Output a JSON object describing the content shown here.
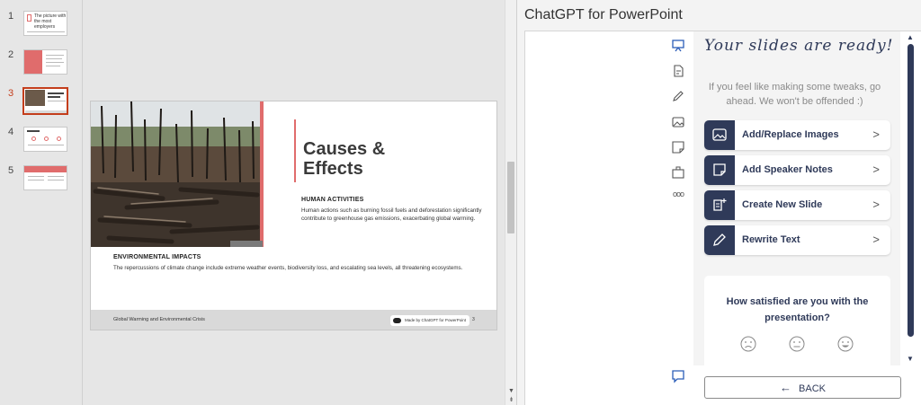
{
  "thumbnails": {
    "items": [
      {
        "num": "1",
        "text": "The picture with the most employers"
      },
      {
        "num": "2",
        "text": ""
      },
      {
        "num": "3",
        "text": "Causes & Effects"
      },
      {
        "num": "4",
        "text": ""
      },
      {
        "num": "5",
        "text": ""
      }
    ],
    "active": "3"
  },
  "slide": {
    "title": "Causes &\nEffects",
    "section1_heading": "HUMAN ACTIVITIES",
    "section1_body": "Human actions such as burning fossil fuels and deforestation significantly contribute to greenhouse gas emissions, exacerbating global warming.",
    "section2_heading": "ENVIRONMENTAL IMPACTS",
    "section2_body": "The repercussions of climate change include extreme weather events, biodiversity loss, and escalating sea levels, all threatening ecosystems.",
    "footer_text": "Global Warming and Environmental Crisis",
    "made_by": "Made by ChatGPT for PowerPoint",
    "page_number": "3"
  },
  "pane": {
    "title": "ChatGPT for PowerPoint",
    "heading": "Your slides are ready!",
    "intro": "If you feel like making some tweaks, go ahead. We won't be offended :)",
    "actions": [
      {
        "label": "Add/Replace Images",
        "icon": "image-icon"
      },
      {
        "label": "Add Speaker Notes",
        "icon": "note-icon"
      },
      {
        "label": "Create New Slide",
        "icon": "new-slide-icon"
      },
      {
        "label": "Rewrite Text",
        "icon": "pencil-icon"
      }
    ],
    "chevron": ">",
    "survey_question": "How satisfied are you with the presentation?",
    "back_label": "BACK",
    "back_arrow": "←",
    "rail_more": "ooo"
  },
  "colors": {
    "accent": "#e06c6c",
    "navy": "#2f3a59",
    "active_thumb": "#c43e1c"
  }
}
